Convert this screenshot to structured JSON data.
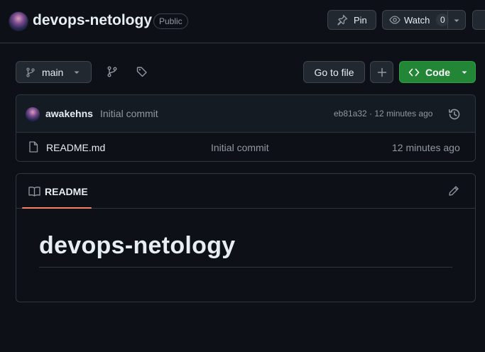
{
  "repo": {
    "name": "devops-netology",
    "visibility": "Public"
  },
  "actions": {
    "pin_label": "Pin",
    "watch_label": "Watch",
    "watch_count": "0"
  },
  "toolbar": {
    "branch": "main",
    "go_to_file": "Go to file",
    "add_file": "+",
    "code_label": "Code"
  },
  "latest_commit": {
    "author": "awakehns",
    "message": "Initial commit",
    "meta": "eb81a32 · 12 minutes ago"
  },
  "files": [
    {
      "name": "README.md",
      "commit": "Initial commit",
      "time": "12 minutes ago"
    }
  ],
  "readme": {
    "tab_label": "README",
    "heading": "devops-netology"
  },
  "colors": {
    "background": "#0d1117",
    "code_button": "#238636",
    "tab_underline": "#f78166"
  }
}
